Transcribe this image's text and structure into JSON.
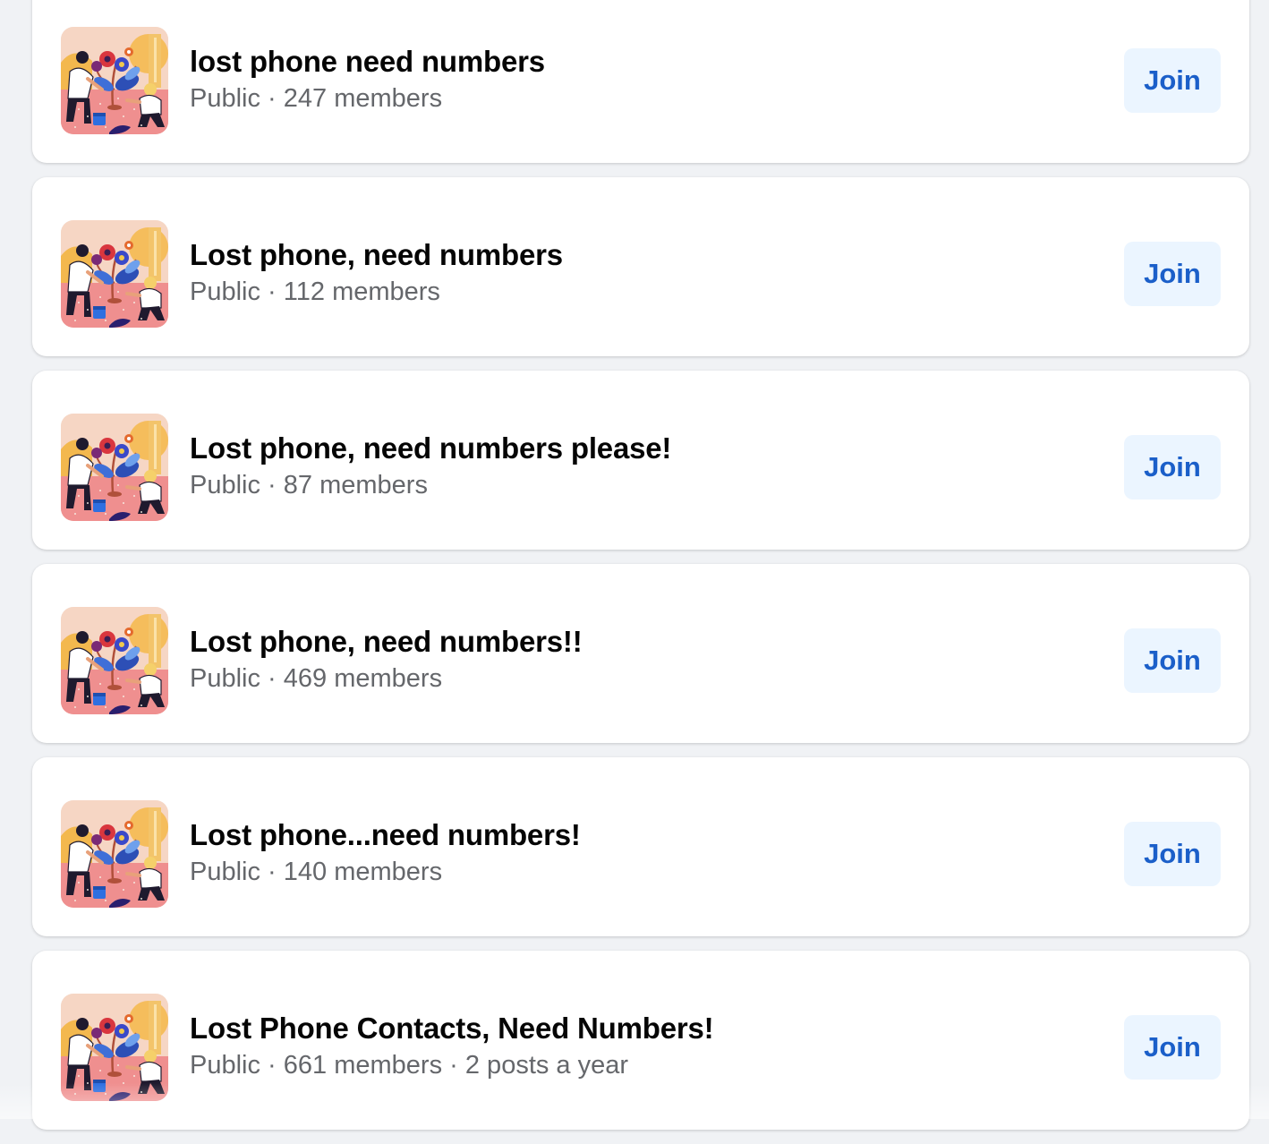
{
  "groups": [
    {
      "name": "lost phone need numbers",
      "privacy": "Public",
      "members": "247 members",
      "activity": "",
      "join_label": "Join"
    },
    {
      "name": "Lost phone, need numbers",
      "privacy": "Public",
      "members": "112 members",
      "activity": "",
      "join_label": "Join"
    },
    {
      "name": "Lost phone, need numbers please!",
      "privacy": "Public",
      "members": "87 members",
      "activity": "",
      "join_label": "Join"
    },
    {
      "name": "Lost phone, need numbers!!",
      "privacy": "Public",
      "members": "469 members",
      "activity": "",
      "join_label": "Join"
    },
    {
      "name": "Lost phone...need numbers!",
      "privacy": "Public",
      "members": "140 members",
      "activity": "",
      "join_label": "Join"
    },
    {
      "name": "Lost Phone Contacts, Need Numbers!",
      "privacy": "Public",
      "members": "661 members",
      "activity": "2 posts a year",
      "join_label": "Join"
    }
  ],
  "separator": " · ",
  "thumbnail_icon": "group-illustration-icon",
  "colors": {
    "background": "#f0f2f5",
    "card": "#ffffff",
    "title": "#050505",
    "meta": "#65676b",
    "join_bg": "#ebf5ff",
    "join_text": "#1b5fc9"
  }
}
